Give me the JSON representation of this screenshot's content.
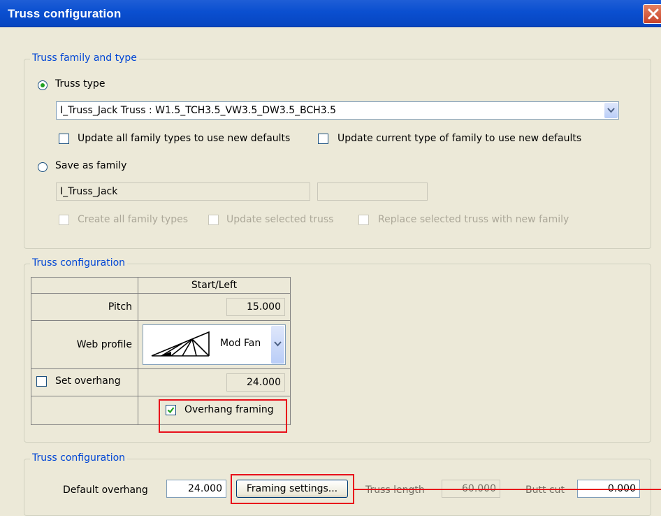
{
  "window": {
    "title": "Truss configuration"
  },
  "family_group": {
    "label": "Truss family and type",
    "truss_type_radio": "Truss type",
    "truss_type_value": "I_Truss_Jack Truss : W1.5_TCH3.5_VW3.5_DW3.5_BCH3.5",
    "update_all_label": "Update all family types to use new defaults",
    "update_current_label": "Update current type of family to use new defaults",
    "save_as_radio": "Save as family",
    "family_name_value": "I_Truss_Jack",
    "family_second_value": "",
    "create_all_label": "Create all family types",
    "update_selected_label": "Update selected truss",
    "replace_selected_label": "Replace selected truss with new family"
  },
  "config_group": {
    "label": "Truss configuration",
    "column_header": "Start/Left",
    "pitch_label": "Pitch",
    "pitch_value": "15.000",
    "web_profile_label": "Web profile",
    "web_profile_value": "Mod Fan",
    "set_overhang_label": "Set overhang",
    "overhang_value": "24.000",
    "overhang_framing_label": "Overhang framing"
  },
  "bottom_group": {
    "label": "Truss configuration",
    "default_overhang_label": "Default overhang",
    "default_overhang_value": "24.000",
    "framing_button": "Framing settings...",
    "truss_length_label": "Truss length",
    "truss_length_value": "60.000",
    "butt_cut_label": "Butt cut",
    "butt_cut_value": "0.000"
  },
  "colors": {
    "title_bar": "#0a4fd0",
    "group_label": "#0046d5",
    "highlight": "#e8101b",
    "check_green": "#21a121"
  },
  "states": {
    "truss_type_selected": true,
    "save_as_selected": false,
    "overhang_framing_checked": true,
    "set_overhang_checked": false
  }
}
